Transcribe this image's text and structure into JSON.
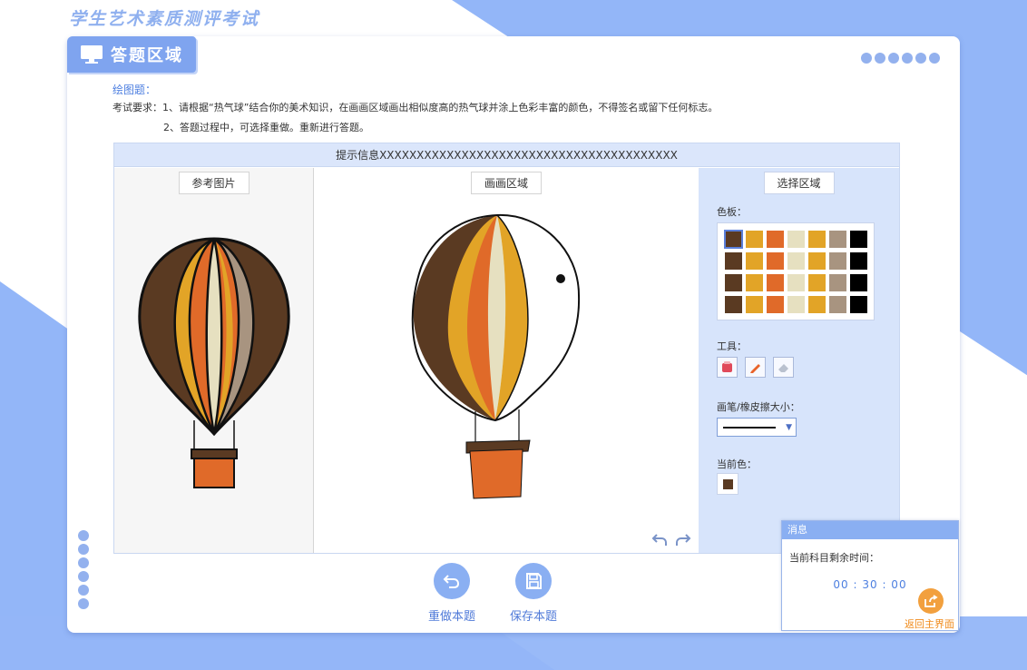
{
  "app": {
    "title": "学生艺术素质测评考试"
  },
  "section": {
    "title": "答题区域"
  },
  "question": {
    "title": "绘图题：",
    "requirement_1": "考试要求：1、请根据“热气球”结合你的美术知识，在画画区域画出相似度高的热气球并涂上色彩丰富的颜色，不得签名或留下任何标志。",
    "requirement_2": "2、答题过程中，可选择重做。重新进行答题。"
  },
  "workspace": {
    "hint": "提示信息XXXXXXXXXXXXXXXXXXXXXXXXXXXXXXXXXXXXXXXX",
    "reference_label": "参考图片",
    "draw_label": "画画区域",
    "select_label": "选择区域"
  },
  "selector": {
    "palette_label": "色板：",
    "tools_label": "工具：",
    "size_label": "画笔/橡皮擦大小：",
    "current_color_label": "当前色：",
    "current_color": "#5a3a22",
    "palette_columns": [
      "#5a3a22",
      "#e2a427",
      "#e06a29",
      "#e6e0c0",
      "#e2a427",
      "#a89480",
      "#000000"
    ],
    "palette_rows": 4,
    "tools": [
      {
        "name": "fill-bucket",
        "active": false
      },
      {
        "name": "pencil",
        "active": false
      },
      {
        "name": "eraser",
        "active": false
      }
    ]
  },
  "actions": {
    "redo_label": "重做本题",
    "save_label": "保存本题"
  },
  "message": {
    "header": "消息",
    "text": "当前科目剩余时间：",
    "timer": "00 : 30 : 00",
    "home_label": "返回主界面"
  },
  "colors": {
    "accent": "#8aaff2",
    "brown": "#5a3a22",
    "orange": "#e06a29",
    "yellow": "#e2a427",
    "cream": "#e6e0c0",
    "taupe": "#a89480",
    "home_orange": "#f2a03e"
  }
}
